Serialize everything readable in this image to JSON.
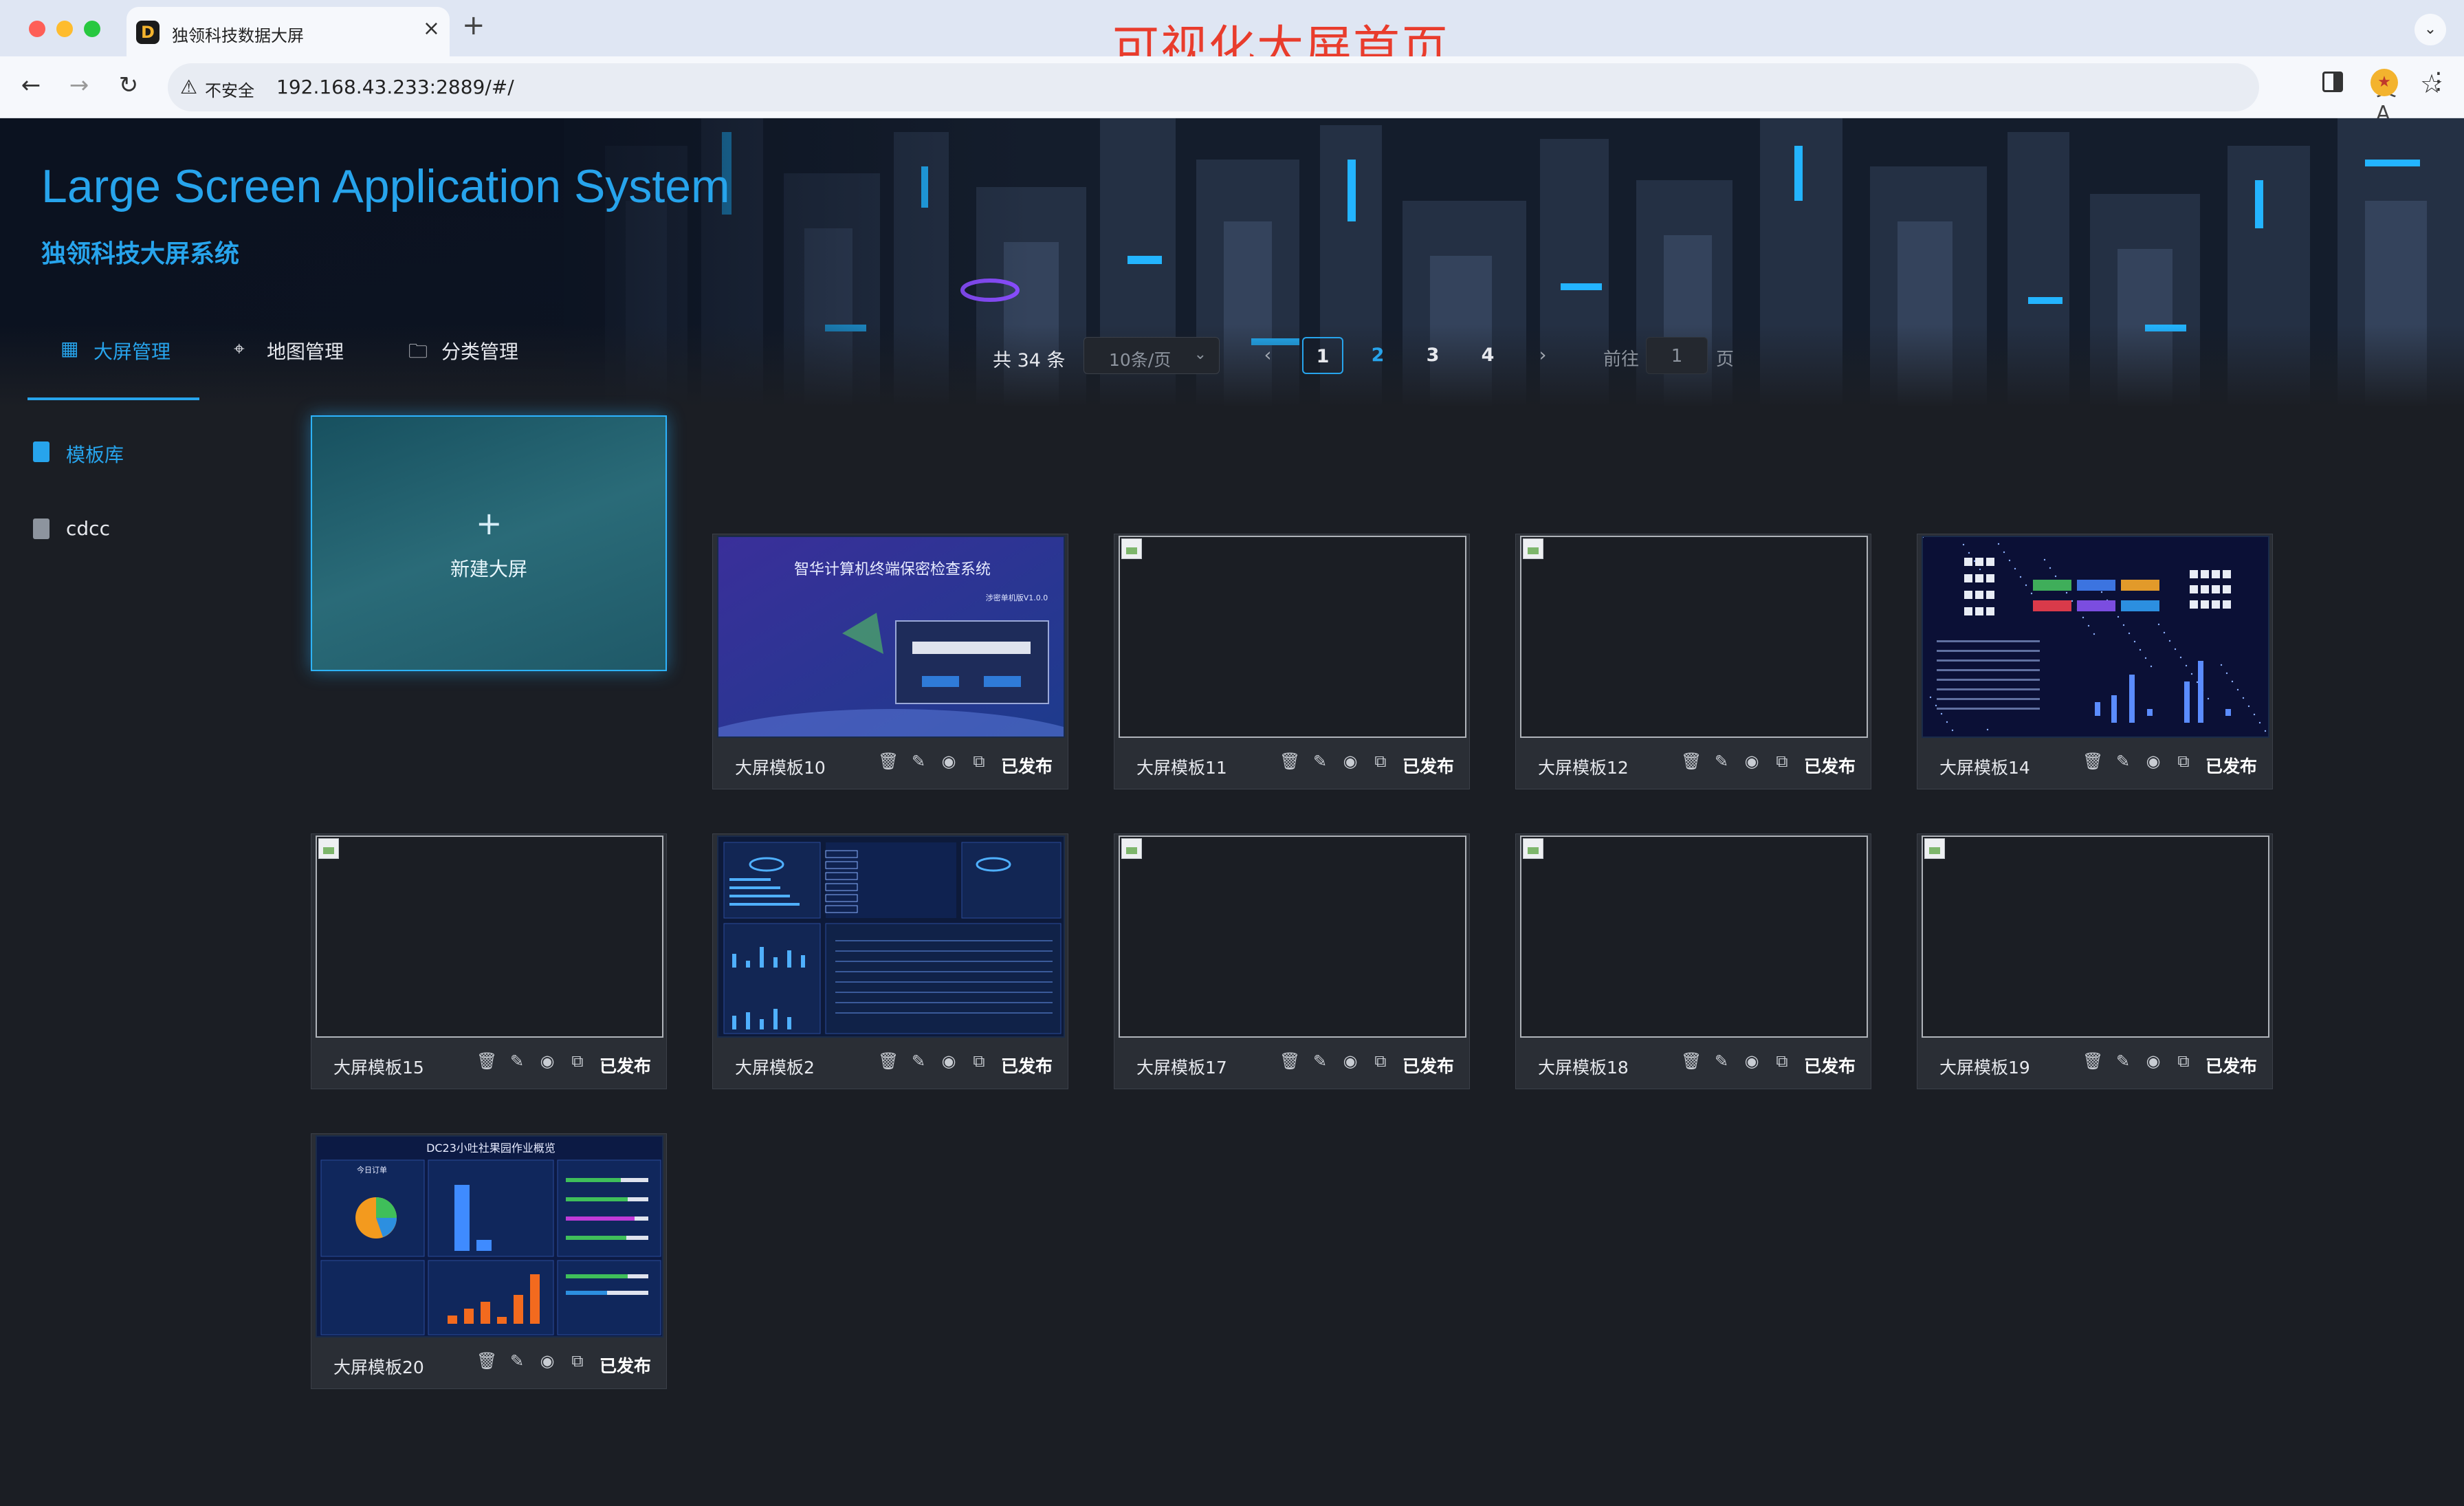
{
  "browser": {
    "tab_title": "独领科技数据大屏",
    "tab_close": "×",
    "new_tab": "+",
    "insecure_label": "不安全",
    "url": "192.168.43.233:2889/#/",
    "annotation": "可视化大屏首页"
  },
  "app": {
    "title_en": "Large Screen Application System",
    "title_cn": "独领科技大屏系统",
    "nav_tabs": [
      {
        "label": "大屏管理",
        "icon": "grid-icon",
        "active": true
      },
      {
        "label": "地图管理",
        "icon": "location-pin-icon",
        "active": false
      },
      {
        "label": "分类管理",
        "icon": "folder-icon",
        "active": false
      }
    ],
    "accent_color": "#27a4ec"
  },
  "sidebar": {
    "items": [
      {
        "label": "模板库",
        "icon": "clipboard-icon",
        "active": true
      },
      {
        "label": "cdcc",
        "icon": "clipboard-icon",
        "active": false
      }
    ]
  },
  "pagination": {
    "total": "共 34 条",
    "page_size": "10条/页",
    "pages": [
      "1",
      "2",
      "3",
      "4"
    ],
    "current": "1",
    "goto_label": "前往",
    "goto_value": "1",
    "goto_suffix": "页"
  },
  "new_screen": {
    "plus": "+",
    "label": "新建大屏"
  },
  "cards": [
    {
      "name": "大屏模板10",
      "status": "已发布",
      "thumb": "login-preview"
    },
    {
      "name": "大屏模板11",
      "status": "已发布",
      "thumb": "broken"
    },
    {
      "name": "大屏模板12",
      "status": "已发布",
      "thumb": "broken"
    },
    {
      "name": "大屏模板14",
      "status": "已发布",
      "thumb": "dashboard-preview"
    },
    {
      "name": "大屏模板15",
      "status": "已发布",
      "thumb": "broken"
    },
    {
      "name": "大屏模板2",
      "status": "已发布",
      "thumb": "table-preview"
    },
    {
      "name": "大屏模板17",
      "status": "已发布",
      "thumb": "broken"
    },
    {
      "name": "大屏模板18",
      "status": "已发布",
      "thumb": "broken"
    },
    {
      "name": "大屏模板19",
      "status": "已发布",
      "thumb": "broken"
    },
    {
      "name": "大屏模板20",
      "status": "已发布",
      "thumb": "stats-preview"
    }
  ],
  "thumbnails": {
    "login_title": "智华计算机终端保密检查系统",
    "login_version": "涉密单机版V1.0.0",
    "stats_title": "DC23小吐社果园作业概览",
    "stats_panel": "今日订单"
  }
}
